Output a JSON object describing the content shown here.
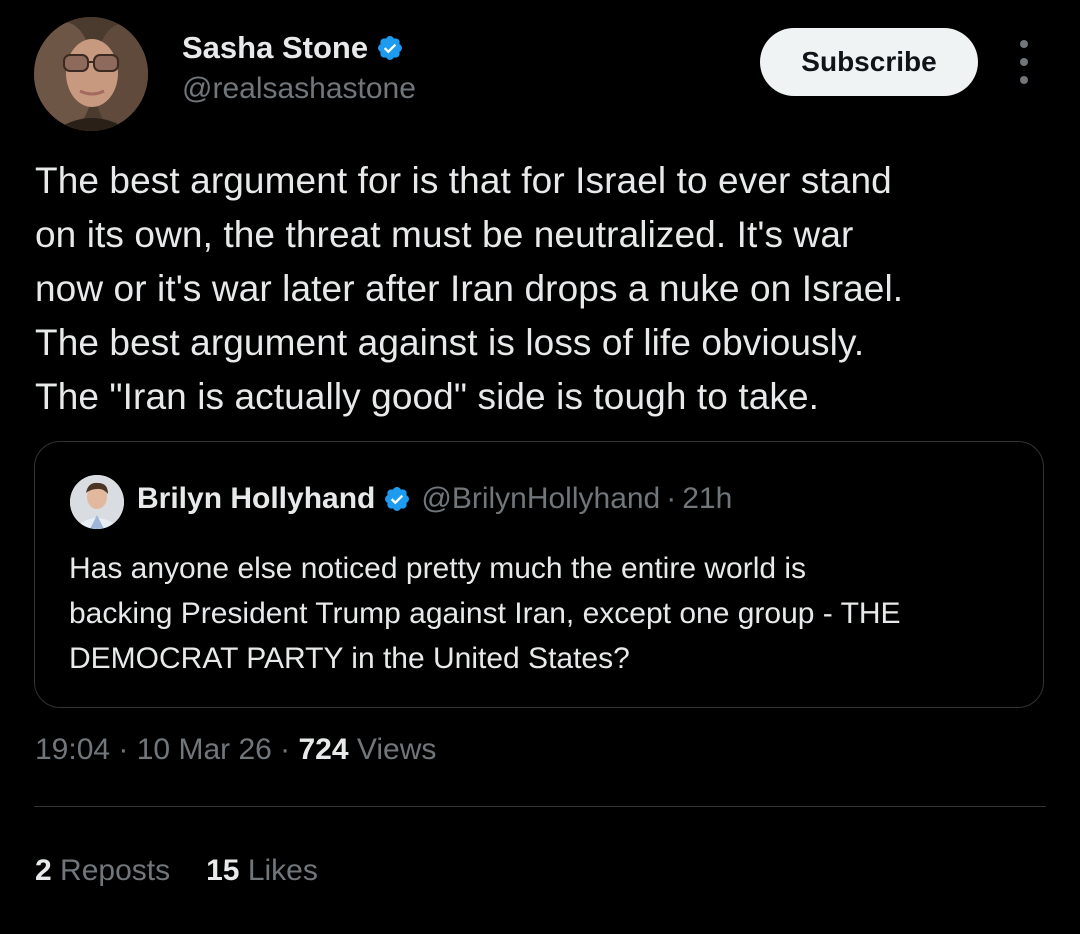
{
  "author": {
    "name": "Sasha Stone",
    "handle": "@realsashastone",
    "verified": true
  },
  "header": {
    "subscribe_label": "Subscribe",
    "more_icon": "more-vertical-icon"
  },
  "tweet": {
    "text": "The best argument for is that for Israel to ever stand\non its own, the threat must be neutralized. It's war\nnow or it's war later after Iran drops a nuke on Israel.\nThe best argument against is loss of life obviously.\nThe \"Iran is actually good\" side is tough to take.",
    "time": "19:04",
    "date": "10 Mar 26",
    "separator": " · ",
    "views_count": "724",
    "views_label": "Views"
  },
  "quote": {
    "name": "Brilyn Hollyhand",
    "handle": "@BrilynHollyhand",
    "separator": "·",
    "time": "21h",
    "verified": true,
    "text": "Has anyone else noticed pretty much the entire world is\nbacking President Trump against Iran, except one group - THE\nDEMOCRAT PARTY in the United States?"
  },
  "stats": {
    "reposts_count": "2",
    "reposts_label": "Reposts",
    "likes_count": "15",
    "likes_label": "Likes"
  },
  "colors": {
    "background": "#000000",
    "text": "#e7e9ea",
    "muted": "#71767b",
    "border": "#2f3336",
    "verified_blue": "#1d9bf0",
    "button_bg": "#eff3f4"
  }
}
